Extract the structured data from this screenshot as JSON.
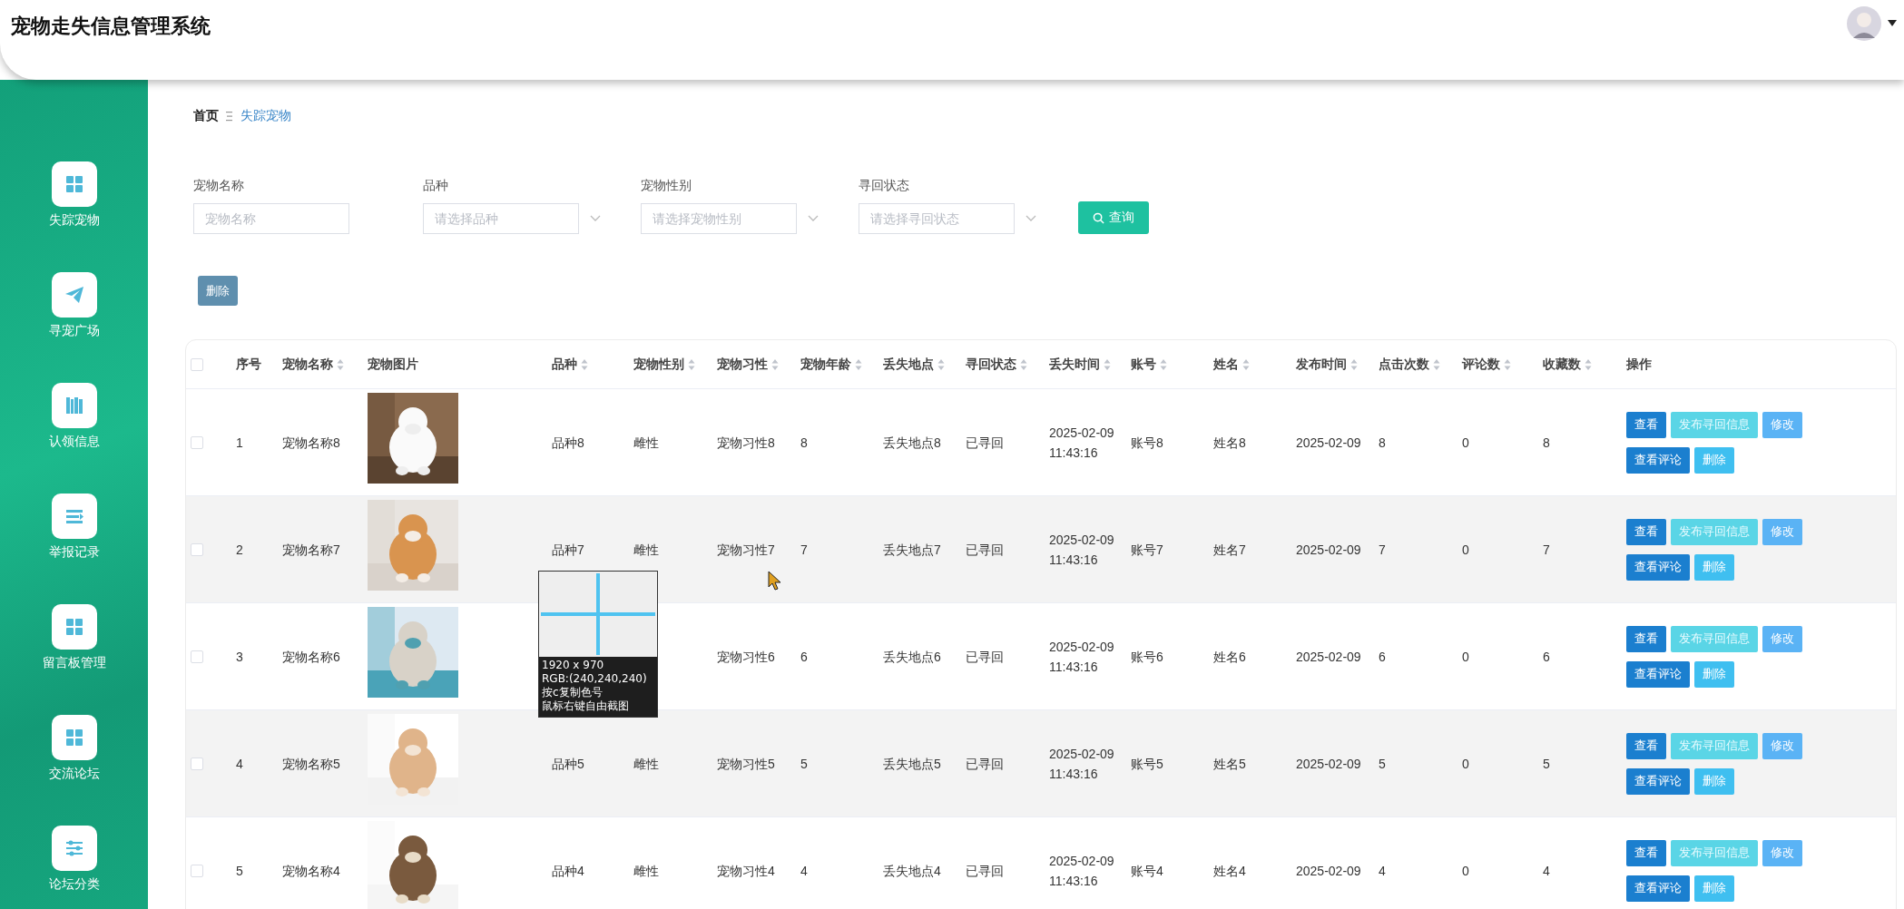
{
  "header": {
    "title": "宠物走失信息管理系统"
  },
  "sidebar": {
    "items": [
      {
        "label": "失踪宠物",
        "kind": "grid"
      },
      {
        "label": "寻宠广场",
        "kind": "plane"
      },
      {
        "label": "认领信息",
        "kind": "book"
      },
      {
        "label": "举报记录",
        "kind": "list"
      },
      {
        "label": "留言板管理",
        "kind": "grid"
      },
      {
        "label": "交流论坛",
        "kind": "grid"
      },
      {
        "label": "论坛分类",
        "kind": "sliders"
      }
    ]
  },
  "breadcrumb": [
    {
      "label": "首页",
      "current": false
    },
    {
      "label": "失踪宠物",
      "current": true
    }
  ],
  "filters": [
    {
      "label": "宠物名称",
      "placeholder": "宠物名称",
      "kind": "input"
    },
    {
      "label": "品种",
      "placeholder": "请选择品种",
      "kind": "select"
    },
    {
      "label": "宠物性别",
      "placeholder": "请选择宠物性别",
      "kind": "select"
    },
    {
      "label": "寻回状态",
      "placeholder": "请选择寻回状态",
      "kind": "select"
    }
  ],
  "search_button": "查询",
  "delete_button": "删除",
  "table": {
    "all_checked": false,
    "columns": [
      {
        "label": "序号",
        "sortable": false
      },
      {
        "label": "宠物名称",
        "sortable": true
      },
      {
        "label": "宠物图片",
        "sortable": false
      },
      {
        "label": "品种",
        "sortable": true
      },
      {
        "label": "宠物性别",
        "sortable": true
      },
      {
        "label": "宠物习性",
        "sortable": true
      },
      {
        "label": "宠物年龄",
        "sortable": true
      },
      {
        "label": "丢失地点",
        "sortable": true
      },
      {
        "label": "寻回状态",
        "sortable": true
      },
      {
        "label": "丢失时间",
        "sortable": true
      },
      {
        "label": "账号",
        "sortable": true
      },
      {
        "label": "姓名",
        "sortable": true
      },
      {
        "label": "发布时间",
        "sortable": true
      },
      {
        "label": "点击次数",
        "sortable": true
      },
      {
        "label": "评论数",
        "sortable": true
      },
      {
        "label": "收藏数",
        "sortable": true
      },
      {
        "label": "操作",
        "sortable": false
      }
    ],
    "rows": [
      {
        "checked": false,
        "cells": [
          "1",
          "宠物名称8",
          {
            "kind": "picture"
          },
          "品种8",
          "雌性",
          "宠物习性8",
          "8",
          "丢失地点8",
          "已寻回",
          "2025-02-09 11:43:16",
          "账号8",
          "姓名8",
          "2025-02-09",
          "8",
          "0",
          "8"
        ],
        "actions": [
          {
            "label": "查看",
            "kind": "view"
          },
          {
            "label": "发布寻回信息",
            "kind": "publish"
          },
          {
            "label": "修改",
            "kind": "edit"
          },
          {
            "label": "查看评论",
            "kind": "view"
          },
          {
            "label": "删除",
            "kind": "delete"
          }
        ]
      },
      {
        "checked": false,
        "cells": [
          "2",
          "宠物名称7",
          {
            "kind": "picture"
          },
          "品种7",
          "雌性",
          "宠物习性7",
          "7",
          "丢失地点7",
          "已寻回",
          "2025-02-09 11:43:16",
          "账号7",
          "姓名7",
          "2025-02-09",
          "7",
          "0",
          "7"
        ],
        "actions": [
          {
            "label": "查看",
            "kind": "view"
          },
          {
            "label": "发布寻回信息",
            "kind": "publish"
          },
          {
            "label": "修改",
            "kind": "edit"
          },
          {
            "label": "查看评论",
            "kind": "view"
          },
          {
            "label": "删除",
            "kind": "delete"
          }
        ]
      },
      {
        "checked": false,
        "cells": [
          "3",
          "宠物名称6",
          {
            "kind": "picture"
          },
          null,
          null,
          "宠物习性6",
          "6",
          "丢失地点6",
          "已寻回",
          "2025-02-09 11:43:16",
          "账号6",
          "姓名6",
          "2025-02-09",
          "6",
          "0",
          "6"
        ],
        "actions": [
          {
            "label": "查看",
            "kind": "view"
          },
          {
            "label": "发布寻回信息",
            "kind": "publish"
          },
          {
            "label": "修改",
            "kind": "edit"
          },
          {
            "label": "查看评论",
            "kind": "view"
          },
          {
            "label": "删除",
            "kind": "delete"
          }
        ]
      },
      {
        "checked": false,
        "cells": [
          "4",
          "宠物名称5",
          {
            "kind": "picture"
          },
          "品种5",
          "雌性",
          "宠物习性5",
          "5",
          "丢失地点5",
          "已寻回",
          "2025-02-09 11:43:16",
          "账号5",
          "姓名5",
          "2025-02-09",
          "5",
          "0",
          "5"
        ],
        "actions": [
          {
            "label": "查看",
            "kind": "view"
          },
          {
            "label": "发布寻回信息",
            "kind": "publish"
          },
          {
            "label": "修改",
            "kind": "edit"
          },
          {
            "label": "查看评论",
            "kind": "view"
          },
          {
            "label": "删除",
            "kind": "delete"
          }
        ]
      },
      {
        "checked": false,
        "cells": [
          "5",
          "宠物名称4",
          {
            "kind": "picture"
          },
          "品种4",
          "雌性",
          "宠物习性4",
          "4",
          "丢失地点4",
          "已寻回",
          "2025-02-09 11:43:16",
          "账号4",
          "姓名4",
          "2025-02-09",
          "4",
          "0",
          "4"
        ],
        "actions": [
          {
            "label": "查看",
            "kind": "view"
          },
          {
            "label": "发布寻回信息",
            "kind": "publish"
          },
          {
            "label": "修改",
            "kind": "edit"
          },
          {
            "label": "查看评论",
            "kind": "view"
          },
          {
            "label": "删除",
            "kind": "delete"
          }
        ]
      }
    ]
  },
  "magnifier": {
    "lines": [
      "1920 x 970",
      "RGB:(240,240,240)",
      "按c复制色号",
      "鼠标右键自由截图"
    ]
  }
}
